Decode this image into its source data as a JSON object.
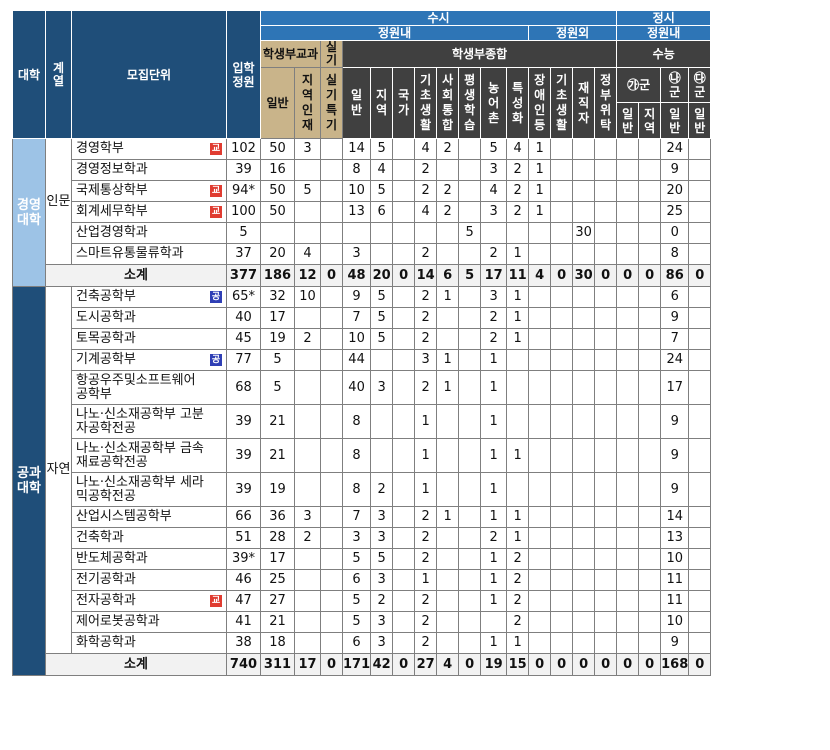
{
  "header": {
    "college": "대학",
    "field": "계열",
    "unit": "모집단위",
    "quota": "입학정원",
    "susi": "수시",
    "jeongsi": "정시",
    "in_quota": "정원내",
    "out_quota": "정원외",
    "jeongsi_in_quota": "정원내",
    "school_grades": "학생부교과",
    "practical": "실기",
    "comprehensive": "학생부종합",
    "suneung": "수능",
    "general": "일반",
    "regional": "지역인재",
    "practical_special": "실기특기",
    "c_general": "일반",
    "c_regional": "지역",
    "c_national": "국가",
    "c_basic": "기초생활",
    "c_social": "사회통합",
    "c_lifelong": "평생학습",
    "c_farm": "농어촌",
    "c_special": "특성화",
    "c_disabled": "장애인등",
    "c_basic2": "기초생활",
    "c_worker": "재직자",
    "c_gov": "정부위탁",
    "ga_group": "㉮군",
    "na_group": "㉯군",
    "da_group": "㉰군",
    "ga_general": "일반",
    "ga_regional": "지역",
    "na_general": "일반",
    "da_general": "일반"
  },
  "sections": [
    {
      "college": "경영대학",
      "field": "인문",
      "rows": [
        {
          "unit": "경영학부",
          "badge": "교",
          "badge_color": "red",
          "quota": "102",
          "v": [
            "50",
            "3",
            "",
            "14",
            "5",
            "",
            "4",
            "2",
            "",
            "5",
            "4",
            "1",
            "",
            "",
            "",
            "",
            "",
            "24",
            ""
          ]
        },
        {
          "unit": "경영정보학과",
          "badge": "",
          "quota": "39",
          "v": [
            "16",
            "",
            "",
            "8",
            "4",
            "",
            "2",
            "",
            "",
            "3",
            "2",
            "1",
            "",
            "",
            "",
            "",
            "",
            "9",
            ""
          ]
        },
        {
          "unit": "국제통상학부",
          "badge": "교",
          "badge_color": "red",
          "quota": "94*",
          "v": [
            "50",
            "5",
            "",
            "10",
            "5",
            "",
            "2",
            "2",
            "",
            "4",
            "2",
            "1",
            "",
            "",
            "",
            "",
            "",
            "20",
            ""
          ]
        },
        {
          "unit": "회계세무학부",
          "badge": "교",
          "badge_color": "red",
          "quota": "100",
          "v": [
            "50",
            "",
            "",
            "13",
            "6",
            "",
            "4",
            "2",
            "",
            "3",
            "2",
            "1",
            "",
            "",
            "",
            "",
            "",
            "25",
            ""
          ]
        },
        {
          "unit": "산업경영학과",
          "badge": "",
          "quota": "5",
          "v": [
            "",
            "",
            "",
            "",
            "",
            "",
            "",
            "",
            "5",
            "",
            "",
            "",
            "",
            "30",
            "",
            "",
            "",
            "0",
            ""
          ]
        },
        {
          "unit": "스마트유통물류학과",
          "badge": "",
          "quota": "37",
          "v": [
            "20",
            "4",
            "",
            "3",
            "",
            "",
            "2",
            "",
            "",
            "2",
            "1",
            "",
            "",
            "",
            "",
            "",
            "",
            "8",
            ""
          ]
        }
      ],
      "subtotal": {
        "label": "소계",
        "quota": "377",
        "v": [
          "186",
          "12",
          "0",
          "48",
          "20",
          "0",
          "14",
          "6",
          "5",
          "17",
          "11",
          "4",
          "0",
          "30",
          "0",
          "0",
          "0",
          "86",
          "0"
        ]
      }
    },
    {
      "college": "공과대학",
      "field": "자연",
      "rows": [
        {
          "unit": "건축공학부",
          "badge": "공",
          "badge_color": "blue",
          "quota": "65*",
          "v": [
            "32",
            "10",
            "",
            "9",
            "5",
            "",
            "2",
            "1",
            "",
            "3",
            "1",
            "",
            "",
            "",
            "",
            "",
            "",
            "6",
            ""
          ]
        },
        {
          "unit": "도시공학과",
          "badge": "",
          "quota": "40",
          "v": [
            "17",
            "",
            "",
            "7",
            "5",
            "",
            "2",
            "",
            "",
            "2",
            "1",
            "",
            "",
            "",
            "",
            "",
            "",
            "9",
            ""
          ]
        },
        {
          "unit": "토목공학과",
          "badge": "",
          "quota": "45",
          "v": [
            "19",
            "2",
            "",
            "10",
            "5",
            "",
            "2",
            "",
            "",
            "2",
            "1",
            "",
            "",
            "",
            "",
            "",
            "",
            "7",
            ""
          ]
        },
        {
          "unit": "기계공학부",
          "badge": "공",
          "badge_color": "blue",
          "quota": "77",
          "v": [
            "5",
            "",
            "",
            "44",
            "",
            "",
            "3",
            "1",
            "",
            "1",
            "",
            "",
            "",
            "",
            "",
            "",
            "",
            "24",
            ""
          ]
        },
        {
          "unit": "항공우주및소프트웨어공학부",
          "badge": "",
          "quota": "68",
          "tall": true,
          "v": [
            "5",
            "",
            "",
            "40",
            "3",
            "",
            "2",
            "1",
            "",
            "1",
            "",
            "",
            "",
            "",
            "",
            "",
            "",
            "17",
            ""
          ]
        },
        {
          "unit": "나노·신소재공학부 고분자공학전공",
          "badge": "",
          "quota": "39",
          "tall": true,
          "v": [
            "21",
            "",
            "",
            "8",
            "",
            "",
            "1",
            "",
            "",
            "1",
            "",
            "",
            "",
            "",
            "",
            "",
            "",
            "9",
            ""
          ]
        },
        {
          "unit": "나노·신소재공학부 금속재료공학전공",
          "badge": "",
          "quota": "39",
          "tall": true,
          "v": [
            "21",
            "",
            "",
            "8",
            "",
            "",
            "1",
            "",
            "",
            "1",
            "1",
            "",
            "",
            "",
            "",
            "",
            "",
            "9",
            ""
          ]
        },
        {
          "unit": "나노·신소재공학부 세라믹공학전공",
          "badge": "",
          "quota": "39",
          "tall": true,
          "v": [
            "19",
            "",
            "",
            "8",
            "2",
            "",
            "1",
            "",
            "",
            "1",
            "",
            "",
            "",
            "",
            "",
            "",
            "",
            "9",
            ""
          ]
        },
        {
          "unit": "산업시스템공학부",
          "badge": "",
          "quota": "66",
          "v": [
            "36",
            "3",
            "",
            "7",
            "3",
            "",
            "2",
            "1",
            "",
            "1",
            "1",
            "",
            "",
            "",
            "",
            "",
            "",
            "14",
            ""
          ]
        },
        {
          "unit": "건축학과",
          "badge": "",
          "quota": "51",
          "v": [
            "28",
            "2",
            "",
            "3",
            "3",
            "",
            "2",
            "",
            "",
            "2",
            "1",
            "",
            "",
            "",
            "",
            "",
            "",
            "13",
            ""
          ]
        },
        {
          "unit": "반도체공학과",
          "badge": "",
          "quota": "39*",
          "v": [
            "17",
            "",
            "",
            "5",
            "5",
            "",
            "2",
            "",
            "",
            "1",
            "2",
            "",
            "",
            "",
            "",
            "",
            "",
            "10",
            ""
          ]
        },
        {
          "unit": "전기공학과",
          "badge": "",
          "quota": "46",
          "v": [
            "25",
            "",
            "",
            "6",
            "3",
            "",
            "1",
            "",
            "",
            "1",
            "2",
            "",
            "",
            "",
            "",
            "",
            "",
            "11",
            ""
          ]
        },
        {
          "unit": "전자공학과",
          "badge": "교",
          "badge_color": "red",
          "quota": "47",
          "v": [
            "27",
            "",
            "",
            "5",
            "2",
            "",
            "2",
            "",
            "",
            "1",
            "2",
            "",
            "",
            "",
            "",
            "",
            "",
            "11",
            ""
          ]
        },
        {
          "unit": "제어로봇공학과",
          "badge": "",
          "quota": "41",
          "v": [
            "21",
            "",
            "",
            "5",
            "3",
            "",
            "2",
            "",
            "",
            "",
            "2",
            "",
            "",
            "",
            "",
            "",
            "",
            "10",
            ""
          ]
        },
        {
          "unit": "화학공학과",
          "badge": "",
          "quota": "38",
          "v": [
            "18",
            "",
            "",
            "6",
            "3",
            "",
            "2",
            "",
            "",
            "1",
            "1",
            "",
            "",
            "",
            "",
            "",
            "",
            "9",
            ""
          ]
        }
      ],
      "subtotal": {
        "label": "소계",
        "quota": "740",
        "v": [
          "311",
          "17",
          "0",
          "171",
          "42",
          "0",
          "27",
          "4",
          "0",
          "19",
          "15",
          "0",
          "0",
          "0",
          "0",
          "0",
          "0",
          "168",
          "0"
        ]
      }
    }
  ]
}
